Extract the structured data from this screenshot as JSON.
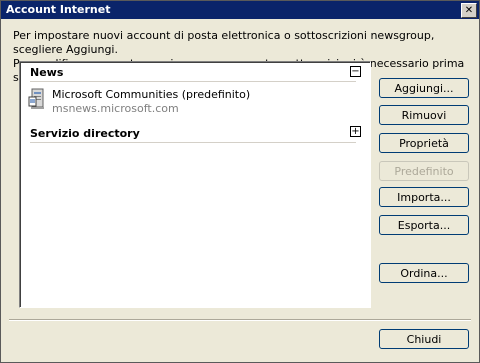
{
  "window": {
    "title": "Account Internet",
    "close_glyph": "✕"
  },
  "instructions": {
    "line1": "Per impostare nuovi account di posta elettronica o sottoscrizioni newsgroup, scegliere Aggiungi.",
    "line2": "Per modificare, esportare o rimuovere account o sottoscrizioni è necessario prima selezionarli."
  },
  "groups": [
    {
      "label": "News",
      "toggle": "−",
      "expanded": true
    },
    {
      "label": "Servizio directory",
      "toggle": "+",
      "expanded": false
    }
  ],
  "account": {
    "name": "Microsoft Communities (predefinito)",
    "server": "msnews.microsoft.com",
    "icon": "news-server-icon"
  },
  "buttons": {
    "add": "Aggiungi...",
    "remove": "Rimuovi",
    "properties": "Proprietà",
    "default": "Predefinito",
    "import": "Importa...",
    "export": "Esporta...",
    "order": "Ordina...",
    "close": "Chiudi"
  }
}
